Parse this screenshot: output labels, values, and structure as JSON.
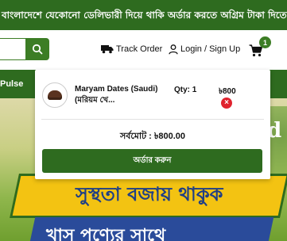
{
  "ticker": {
    "text": "বাংলাদেশে যেকোনো ডেলিভারী দিয়ে থাকি অর্ডার করতে অগ্রিম টাকা দিতে হবে"
  },
  "header": {
    "track_label": "Track Order",
    "login_label": "Login / Sign Up",
    "cart_count": "1"
  },
  "nav": {
    "visible_label": "Pulse"
  },
  "cart_dropdown": {
    "item": {
      "name_line1": "Maryam Dates (Saudi)",
      "name_line2": "(মরিয়ম খে...",
      "qty_label": "Qty: 1",
      "price": "৳800",
      "remove_symbol": "×"
    },
    "subtotal": "সর্বমোট : ৳800.00",
    "order_button": "অর্ডার করুন"
  },
  "banner": {
    "partial_word": "d",
    "headline": "সুস্থতা বজায় থাকুক",
    "subline": "খাস পণ্যের সাথে"
  },
  "colors": {
    "brand_green": "#2e6b1f",
    "accent_green": "#3c7d25",
    "remove_red": "#e0232e",
    "banner_yellow": "#f3c312",
    "banner_blue": "#2a4b9a"
  }
}
